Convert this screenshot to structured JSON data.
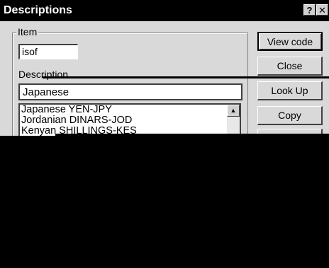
{
  "window": {
    "title": "Descriptions",
    "help_glyph": "?",
    "close_glyph": "✕"
  },
  "item": {
    "caption": "Item",
    "value": "isof"
  },
  "description": {
    "label": "Description",
    "value": "Japanese",
    "list": [
      "Japanese YEN-JPY",
      "Jordanian DINARS-JOD",
      "Kenyan SHILLINGS-KES"
    ],
    "scroll_up_glyph": "▲"
  },
  "buttons": {
    "view_code": "View code",
    "close": "Close",
    "look_up": "Look Up",
    "copy": "Copy"
  },
  "colors": {
    "titlebar": "#000000",
    "face": "#d9d9d9",
    "redaction": "#000000"
  }
}
